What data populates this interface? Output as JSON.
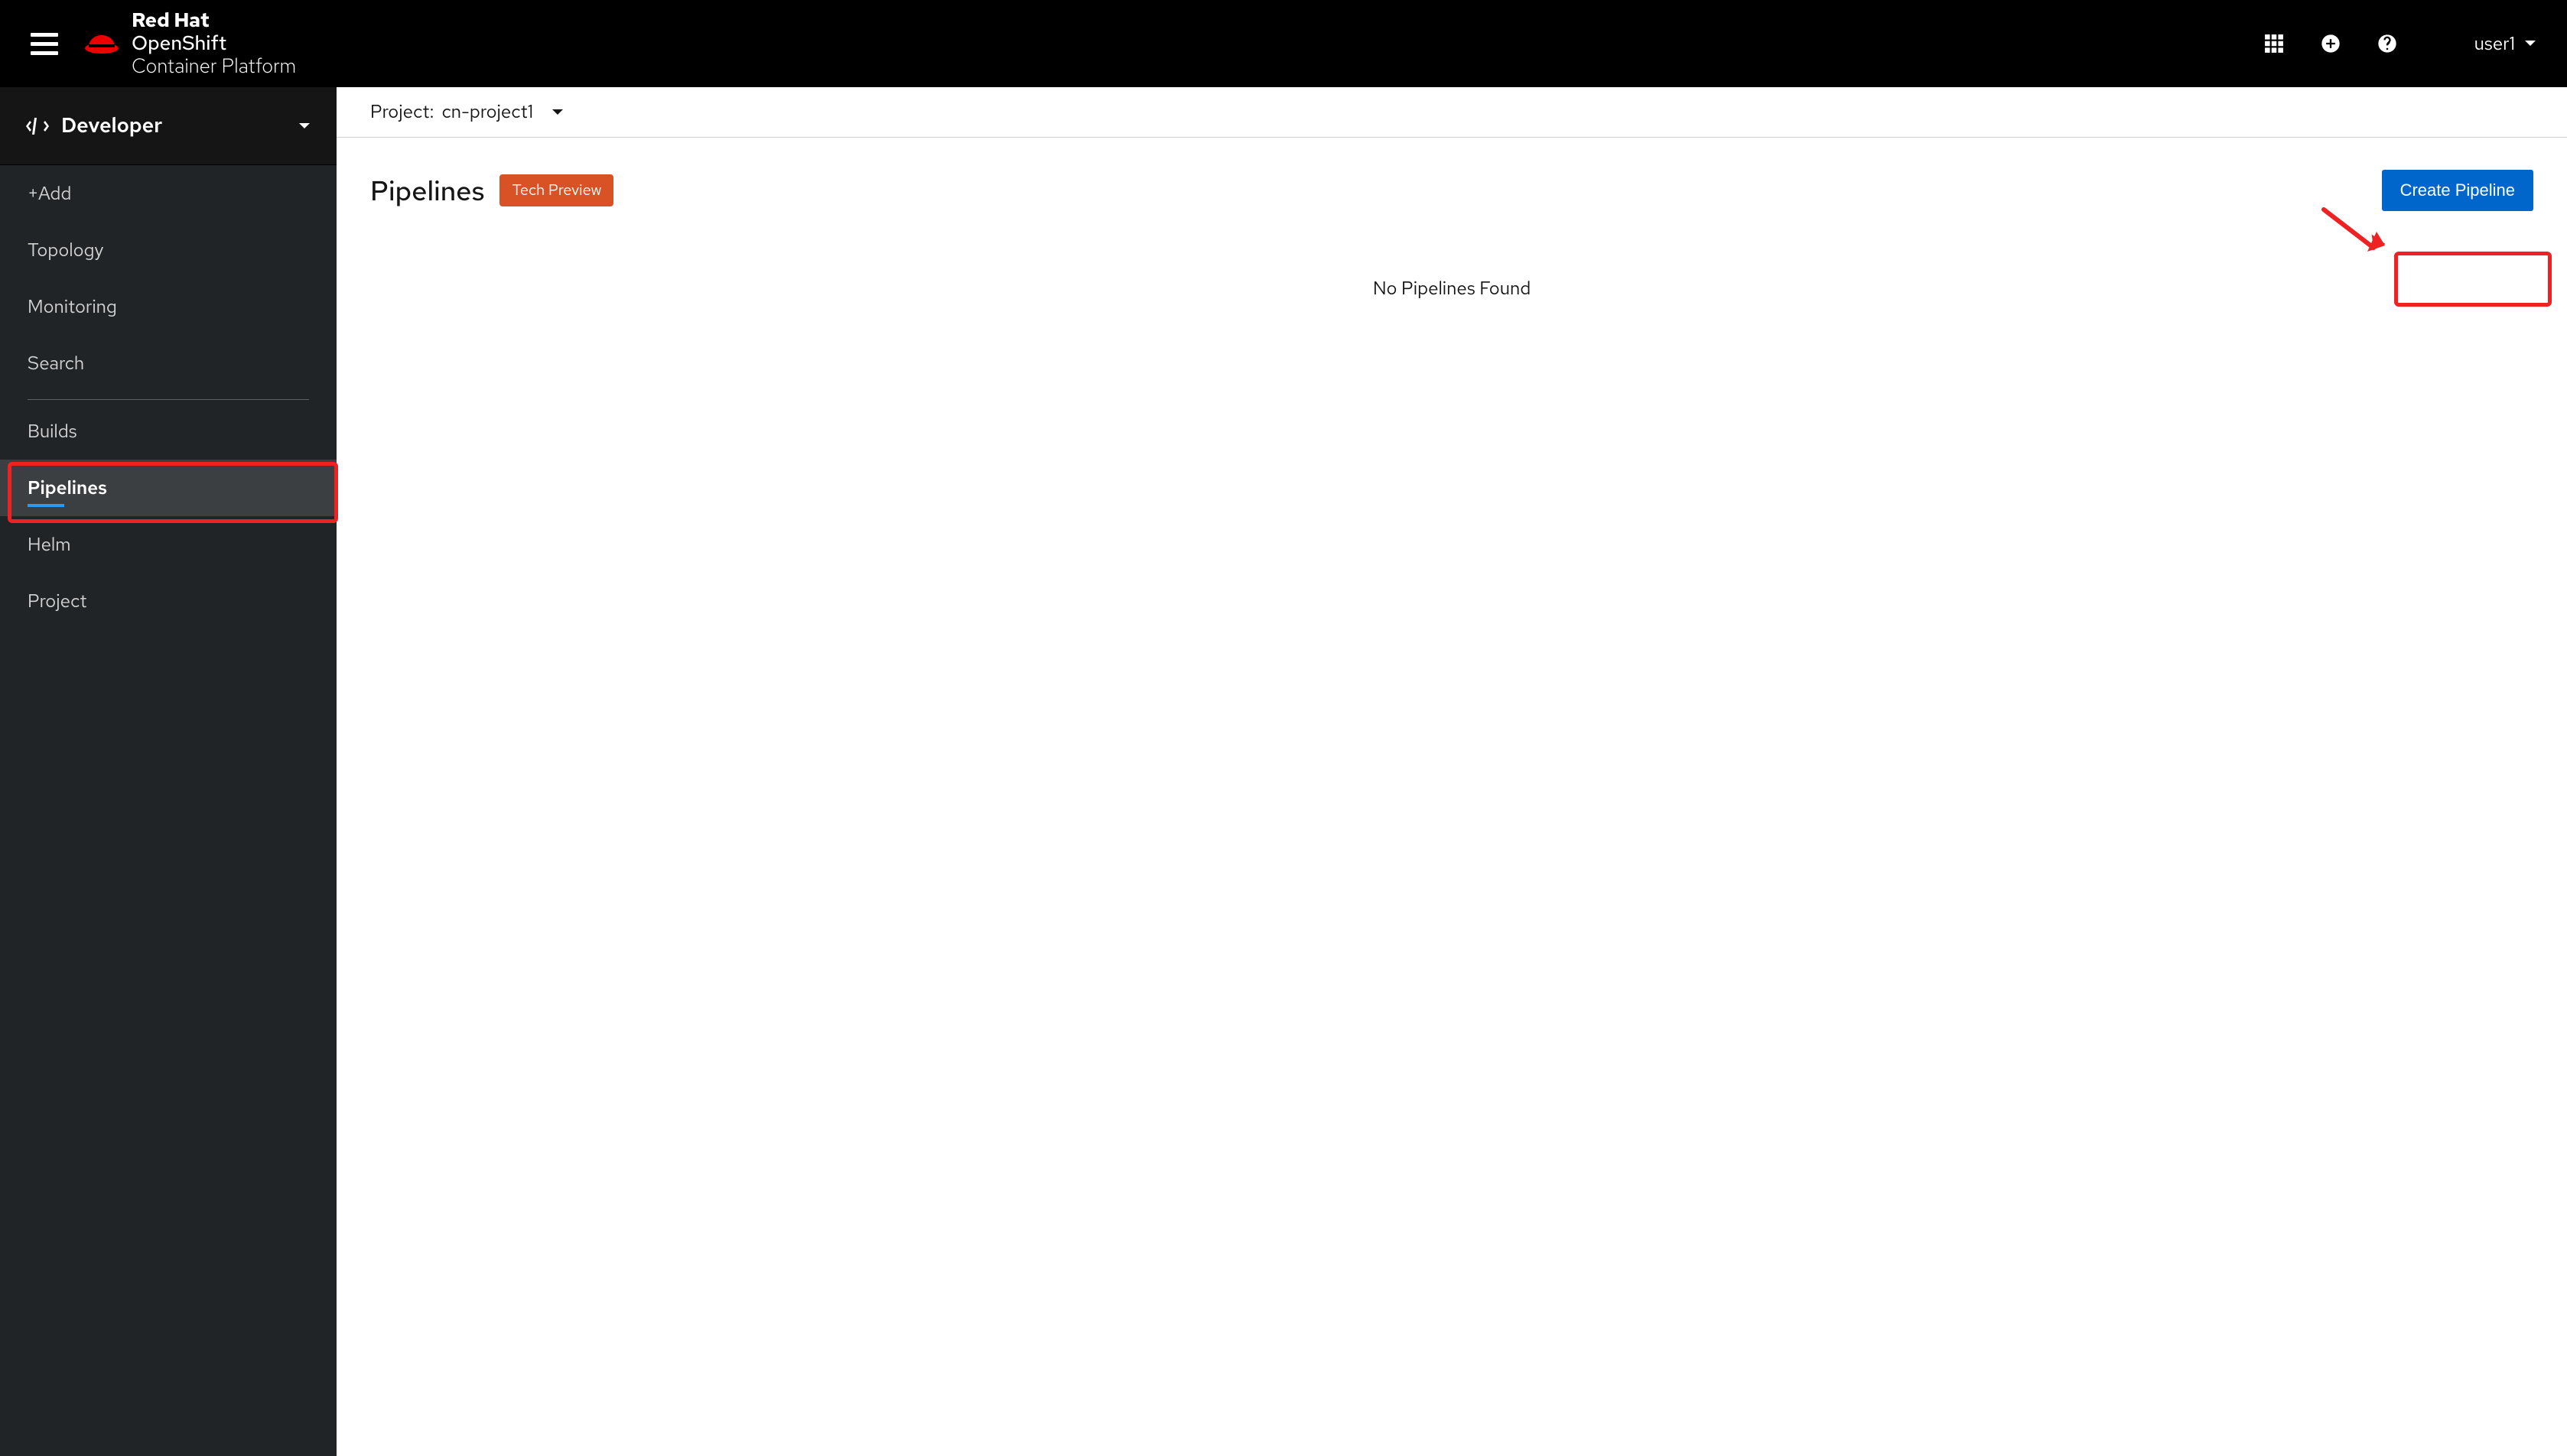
{
  "brand": {
    "line1": "Red Hat",
    "line2": "OpenShift",
    "line3": "Container Platform"
  },
  "user": {
    "name": "user1"
  },
  "perspective": {
    "label": "Developer"
  },
  "sidebar": {
    "items": [
      {
        "label": "+Add"
      },
      {
        "label": "Topology"
      },
      {
        "label": "Monitoring"
      },
      {
        "label": "Search"
      },
      {
        "label": "Builds"
      },
      {
        "label": "Pipelines"
      },
      {
        "label": "Helm"
      },
      {
        "label": "Project"
      }
    ]
  },
  "project": {
    "prefix": "Project:",
    "name": "cn-project1"
  },
  "page": {
    "title": "Pipelines",
    "badge": "Tech Preview",
    "create_button": "Create Pipeline",
    "empty": "No Pipelines Found"
  }
}
